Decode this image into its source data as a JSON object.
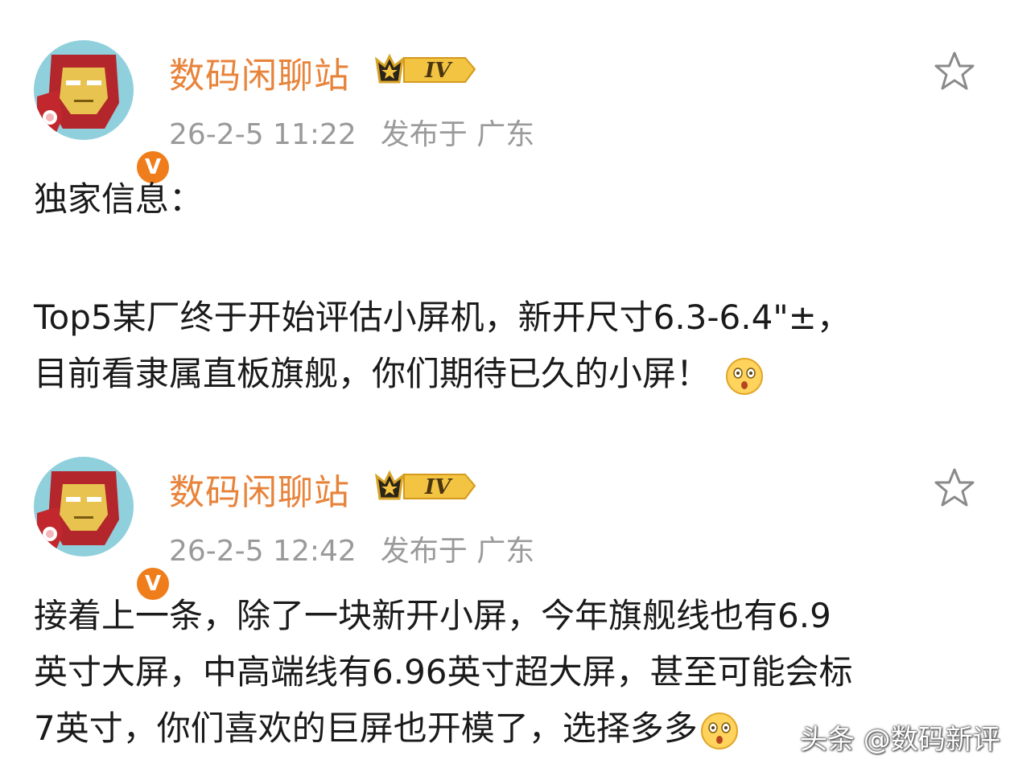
{
  "posts": [
    {
      "username": "数码闲聊站",
      "level_badge": "IV",
      "timestamp": "26-2-5 11:22",
      "location": "发布于 广东",
      "lines": [
        "独家信息：",
        "Top5某厂终于开始评估小屏机，新开尺寸6.3-6.4\"±，",
        "目前看隶属直板旗舰，你们期待已久的小屏！"
      ],
      "emoji": "shocked-face-emoji"
    },
    {
      "username": "数码闲聊站",
      "level_badge": "IV",
      "timestamp": "26-2-5 12:42",
      "location": "发布于 广东",
      "lines": [
        "接着上一条，除了一块新开小屏，今年旗舰线也有6.9",
        "英寸大屏，中高端线有6.96英寸超大屏，甚至可能会标",
        "7英寸，你们喜欢的巨屏也开模了，选择多多"
      ],
      "emoji": "shocked-face-emoji"
    }
  ],
  "verified_mark": "V",
  "watermark": "头条 @数码新评",
  "colors": {
    "username": "#e8833a",
    "meta": "#9a9a9a",
    "verified": "#f07d1b",
    "text": "#1a1a1a"
  }
}
